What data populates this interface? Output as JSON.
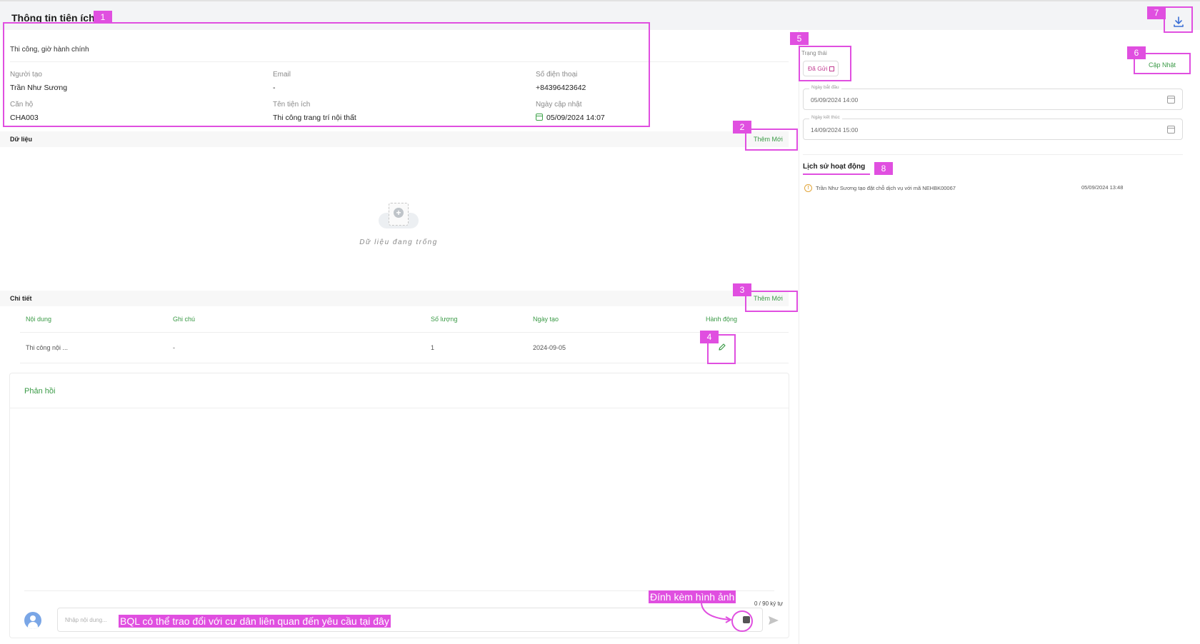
{
  "header": {
    "title": "Thông tin tiện ích"
  },
  "info": {
    "category": "Thi công, giờ hành chính",
    "fields": [
      {
        "label": "Người tạo",
        "value": "Trần Như Sương"
      },
      {
        "label": "Email",
        "value": "-"
      },
      {
        "label": "Số điện thoại",
        "value": "+84396423642"
      },
      {
        "label": "Căn hộ",
        "value": "CHA003"
      },
      {
        "label": "Tên tiện ích",
        "value": "Thi công trang trí nội thất"
      },
      {
        "label": "Ngày cập nhật",
        "value": "05/09/2024 14:07"
      }
    ]
  },
  "data_section": {
    "title": "Dữ liệu",
    "add_label": "Thêm Mới",
    "empty_text": "Dữ liệu đang trống"
  },
  "detail_section": {
    "title": "Chi tiết",
    "add_label": "Thêm Mới",
    "columns": [
      "Nội dung",
      "Ghi chú",
      "Số lượng",
      "Ngày tạo",
      "Hành động"
    ],
    "rows": [
      {
        "content": "Thi công nội ...",
        "note": "-",
        "quantity": "1",
        "created": "2024-09-05"
      }
    ]
  },
  "feedback": {
    "title": "Phản hồi",
    "counter": "0 / 90 ký tự",
    "placeholder": "Nhập nội dung..."
  },
  "status": {
    "label": "Trạng thái",
    "value": "Đã Gửi"
  },
  "actions": {
    "update_label": "Cập Nhật"
  },
  "dates": {
    "start_label": "Ngày bắt đầu",
    "start_value": "05/09/2024 14:00",
    "end_label": "Ngày kết thúc",
    "end_value": "14/09/2024 15:00"
  },
  "history": {
    "title": "Lịch sử hoạt động",
    "items": [
      {
        "text": "Trần Như Sương tạo đặt chỗ dịch vụ với mã NEHBK00067",
        "time": "05/09/2024 13:48"
      }
    ]
  },
  "annotations": {
    "numbers": [
      "1",
      "2",
      "3",
      "4",
      "5",
      "6",
      "7",
      "8"
    ],
    "attach_note": "Đính kèm hình ảnh",
    "input_note": "BQL có thể trao đổi với cư dân liên quan đến yêu cầu tại đây"
  },
  "colors": {
    "accent_green": "#3a9a46",
    "annotation_magenta": "#e04fe0",
    "status_pink": "#c0398f"
  },
  "icons": [
    "calendar-icon",
    "download-icon",
    "edit-icon",
    "image-icon",
    "send-icon",
    "info-icon",
    "avatar-icon",
    "plus-icon"
  ]
}
